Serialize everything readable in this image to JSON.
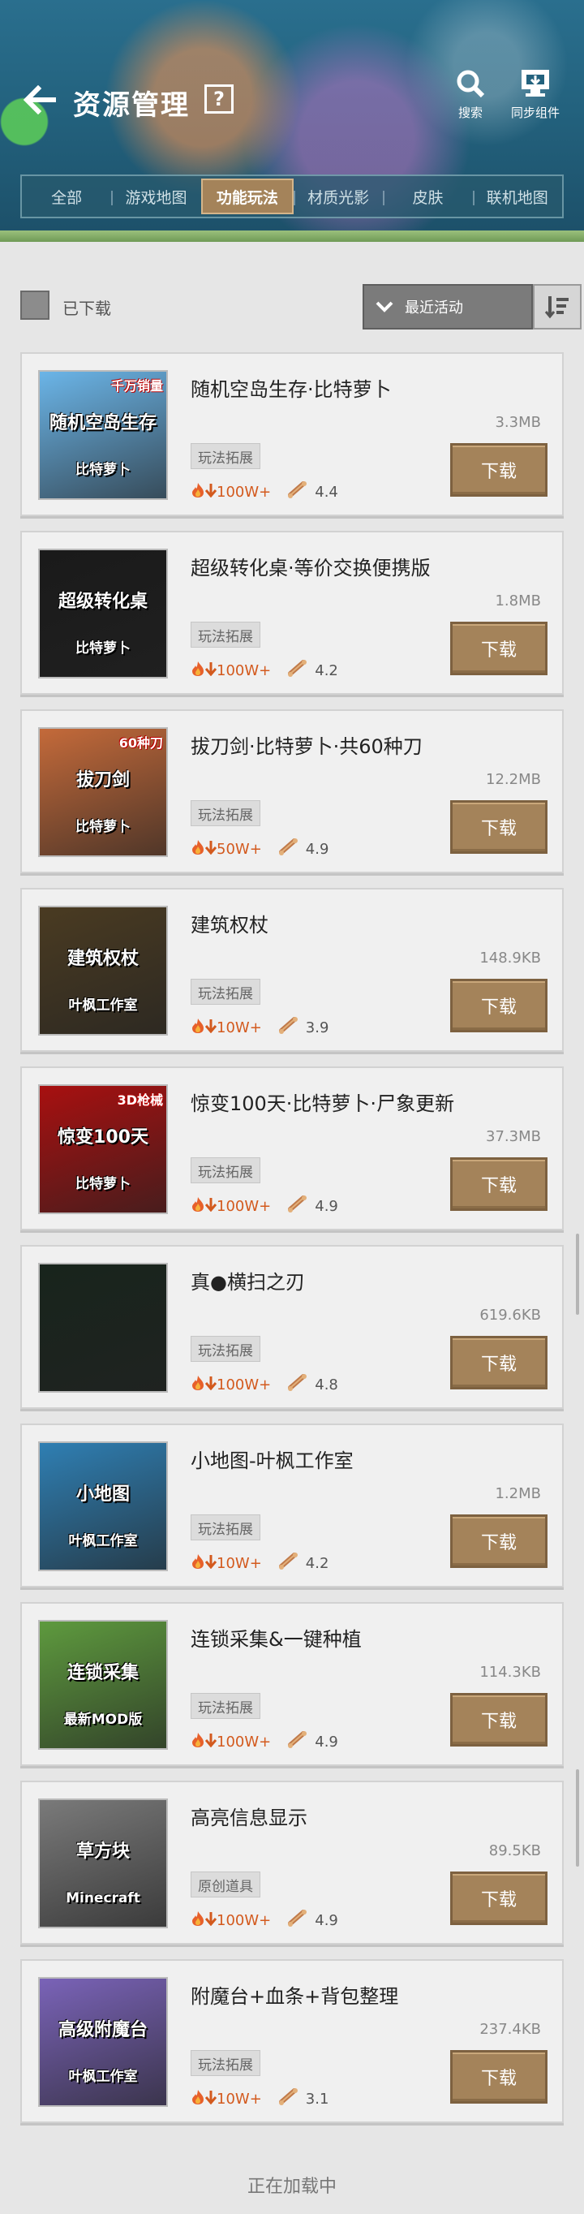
{
  "header": {
    "title": "资源管理",
    "help_label": "?",
    "search_label": "搜索",
    "sync_label": "同步组件"
  },
  "tabs": [
    {
      "label": "全部",
      "active": false
    },
    {
      "label": "游戏地图",
      "active": false
    },
    {
      "label": "功能玩法",
      "active": true
    },
    {
      "label": "材质光影",
      "active": false
    },
    {
      "label": "皮肤",
      "active": false
    },
    {
      "label": "联机地图",
      "active": false
    }
  ],
  "filter": {
    "downloaded_label": "已下载",
    "downloaded_checked": false,
    "sort_label": "最近活动"
  },
  "items": [
    {
      "title": "随机空岛生存·比特萝卜",
      "size": "3.3MB",
      "tag": "玩法拓展",
      "downloads": "100W+",
      "rating": "4.4",
      "button": "下载",
      "thumb_text": "随机空岛生存",
      "thumb_sub": "比特萝卜",
      "thumb_badge": "千万销量",
      "thumb_color": "#6bb5e8"
    },
    {
      "title": "超级转化桌·等价交换便携版",
      "size": "1.8MB",
      "tag": "玩法拓展",
      "downloads": "100W+",
      "rating": "4.2",
      "button": "下载",
      "thumb_text": "超级转化桌",
      "thumb_sub": "比特萝卜",
      "thumb_badge": "",
      "thumb_color": "#1a1a1a"
    },
    {
      "title": "拔刀剑·比特萝卜·共60种刀",
      "size": "12.2MB",
      "tag": "玩法拓展",
      "downloads": "50W+",
      "rating": "4.9",
      "button": "下载",
      "thumb_text": "拔刀剑",
      "thumb_sub": "比特萝卜",
      "thumb_badge": "60种刀",
      "thumb_color": "#c46a3a"
    },
    {
      "title": "建筑权杖",
      "size": "148.9KB",
      "tag": "玩法拓展",
      "downloads": "10W+",
      "rating": "3.9",
      "button": "下载",
      "thumb_text": "建筑权杖",
      "thumb_sub": "叶枫工作室",
      "thumb_badge": "",
      "thumb_color": "#4a3b22"
    },
    {
      "title": "惊变100天·比特萝卜·尸象更新",
      "size": "37.3MB",
      "tag": "玩法拓展",
      "downloads": "100W+",
      "rating": "4.9",
      "button": "下载",
      "thumb_text": "惊变100天",
      "thumb_sub": "比特萝卜",
      "thumb_badge": "3D枪械",
      "thumb_color": "#a81010"
    },
    {
      "title": "真●横扫之刃",
      "size": "619.6KB",
      "tag": "玩法拓展",
      "downloads": "100W+",
      "rating": "4.8",
      "button": "下载",
      "thumb_text": "",
      "thumb_sub": "",
      "thumb_badge": "",
      "thumb_color": "#18241c"
    },
    {
      "title": "小地图-叶枫工作室",
      "size": "1.2MB",
      "tag": "玩法拓展",
      "downloads": "10W+",
      "rating": "4.2",
      "button": "下载",
      "thumb_text": "小地图",
      "thumb_sub": "叶枫工作室",
      "thumb_badge": "",
      "thumb_color": "#2f7fb3"
    },
    {
      "title": "连锁采集&一键种植",
      "size": "114.3KB",
      "tag": "玩法拓展",
      "downloads": "100W+",
      "rating": "4.9",
      "button": "下载",
      "thumb_text": "连锁采集",
      "thumb_sub": "最新MOD版",
      "thumb_badge": "",
      "thumb_color": "#5e9a3e"
    },
    {
      "title": "高亮信息显示",
      "size": "89.5KB",
      "tag": "原创道具",
      "downloads": "100W+",
      "rating": "4.9",
      "button": "下载",
      "thumb_text": "草方块",
      "thumb_sub": "Minecraft",
      "thumb_badge": "",
      "thumb_color": "#7a7a7a"
    },
    {
      "title": "附魔台+血条+背包整理",
      "size": "237.4KB",
      "tag": "玩法拓展",
      "downloads": "10W+",
      "rating": "3.1",
      "button": "下载",
      "thumb_text": "高级附魔台",
      "thumb_sub": "叶枫工作室",
      "thumb_badge": "",
      "thumb_color": "#7a63b8"
    }
  ],
  "loading_text": "正在加载中",
  "colors": {
    "accent": "#a4835a",
    "header_bg": "#23627e",
    "downloads": "#d35a1e"
  }
}
